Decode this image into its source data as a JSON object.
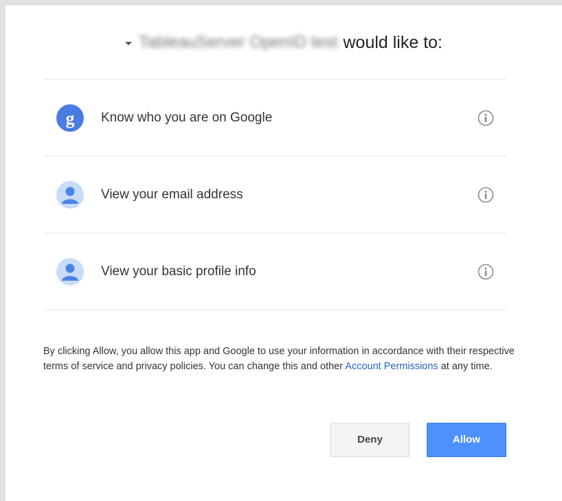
{
  "header": {
    "app_name": "TableauServer OpenID test",
    "suffix": "would like to:"
  },
  "permissions": [
    {
      "label": "Know who you are on Google",
      "icon": "google-plus-icon"
    },
    {
      "label": "View your email address",
      "icon": "person-icon"
    },
    {
      "label": "View your basic profile info",
      "icon": "person-icon"
    }
  ],
  "consent": {
    "text_before": "By clicking Allow, you allow this app and Google to use your information in accordance with their respective terms of service and privacy policies. You can change this and other ",
    "link_text": "Account Permissions",
    "text_after": " at any time."
  },
  "buttons": {
    "deny_label": "Deny",
    "allow_label": "Allow"
  },
  "colors": {
    "accent": "#4d90fe",
    "link": "#2a62c9",
    "google_icon": "#4a7be3",
    "person_icon_bg": "#c8dcf8",
    "person_icon_fg": "#4a84e6"
  }
}
